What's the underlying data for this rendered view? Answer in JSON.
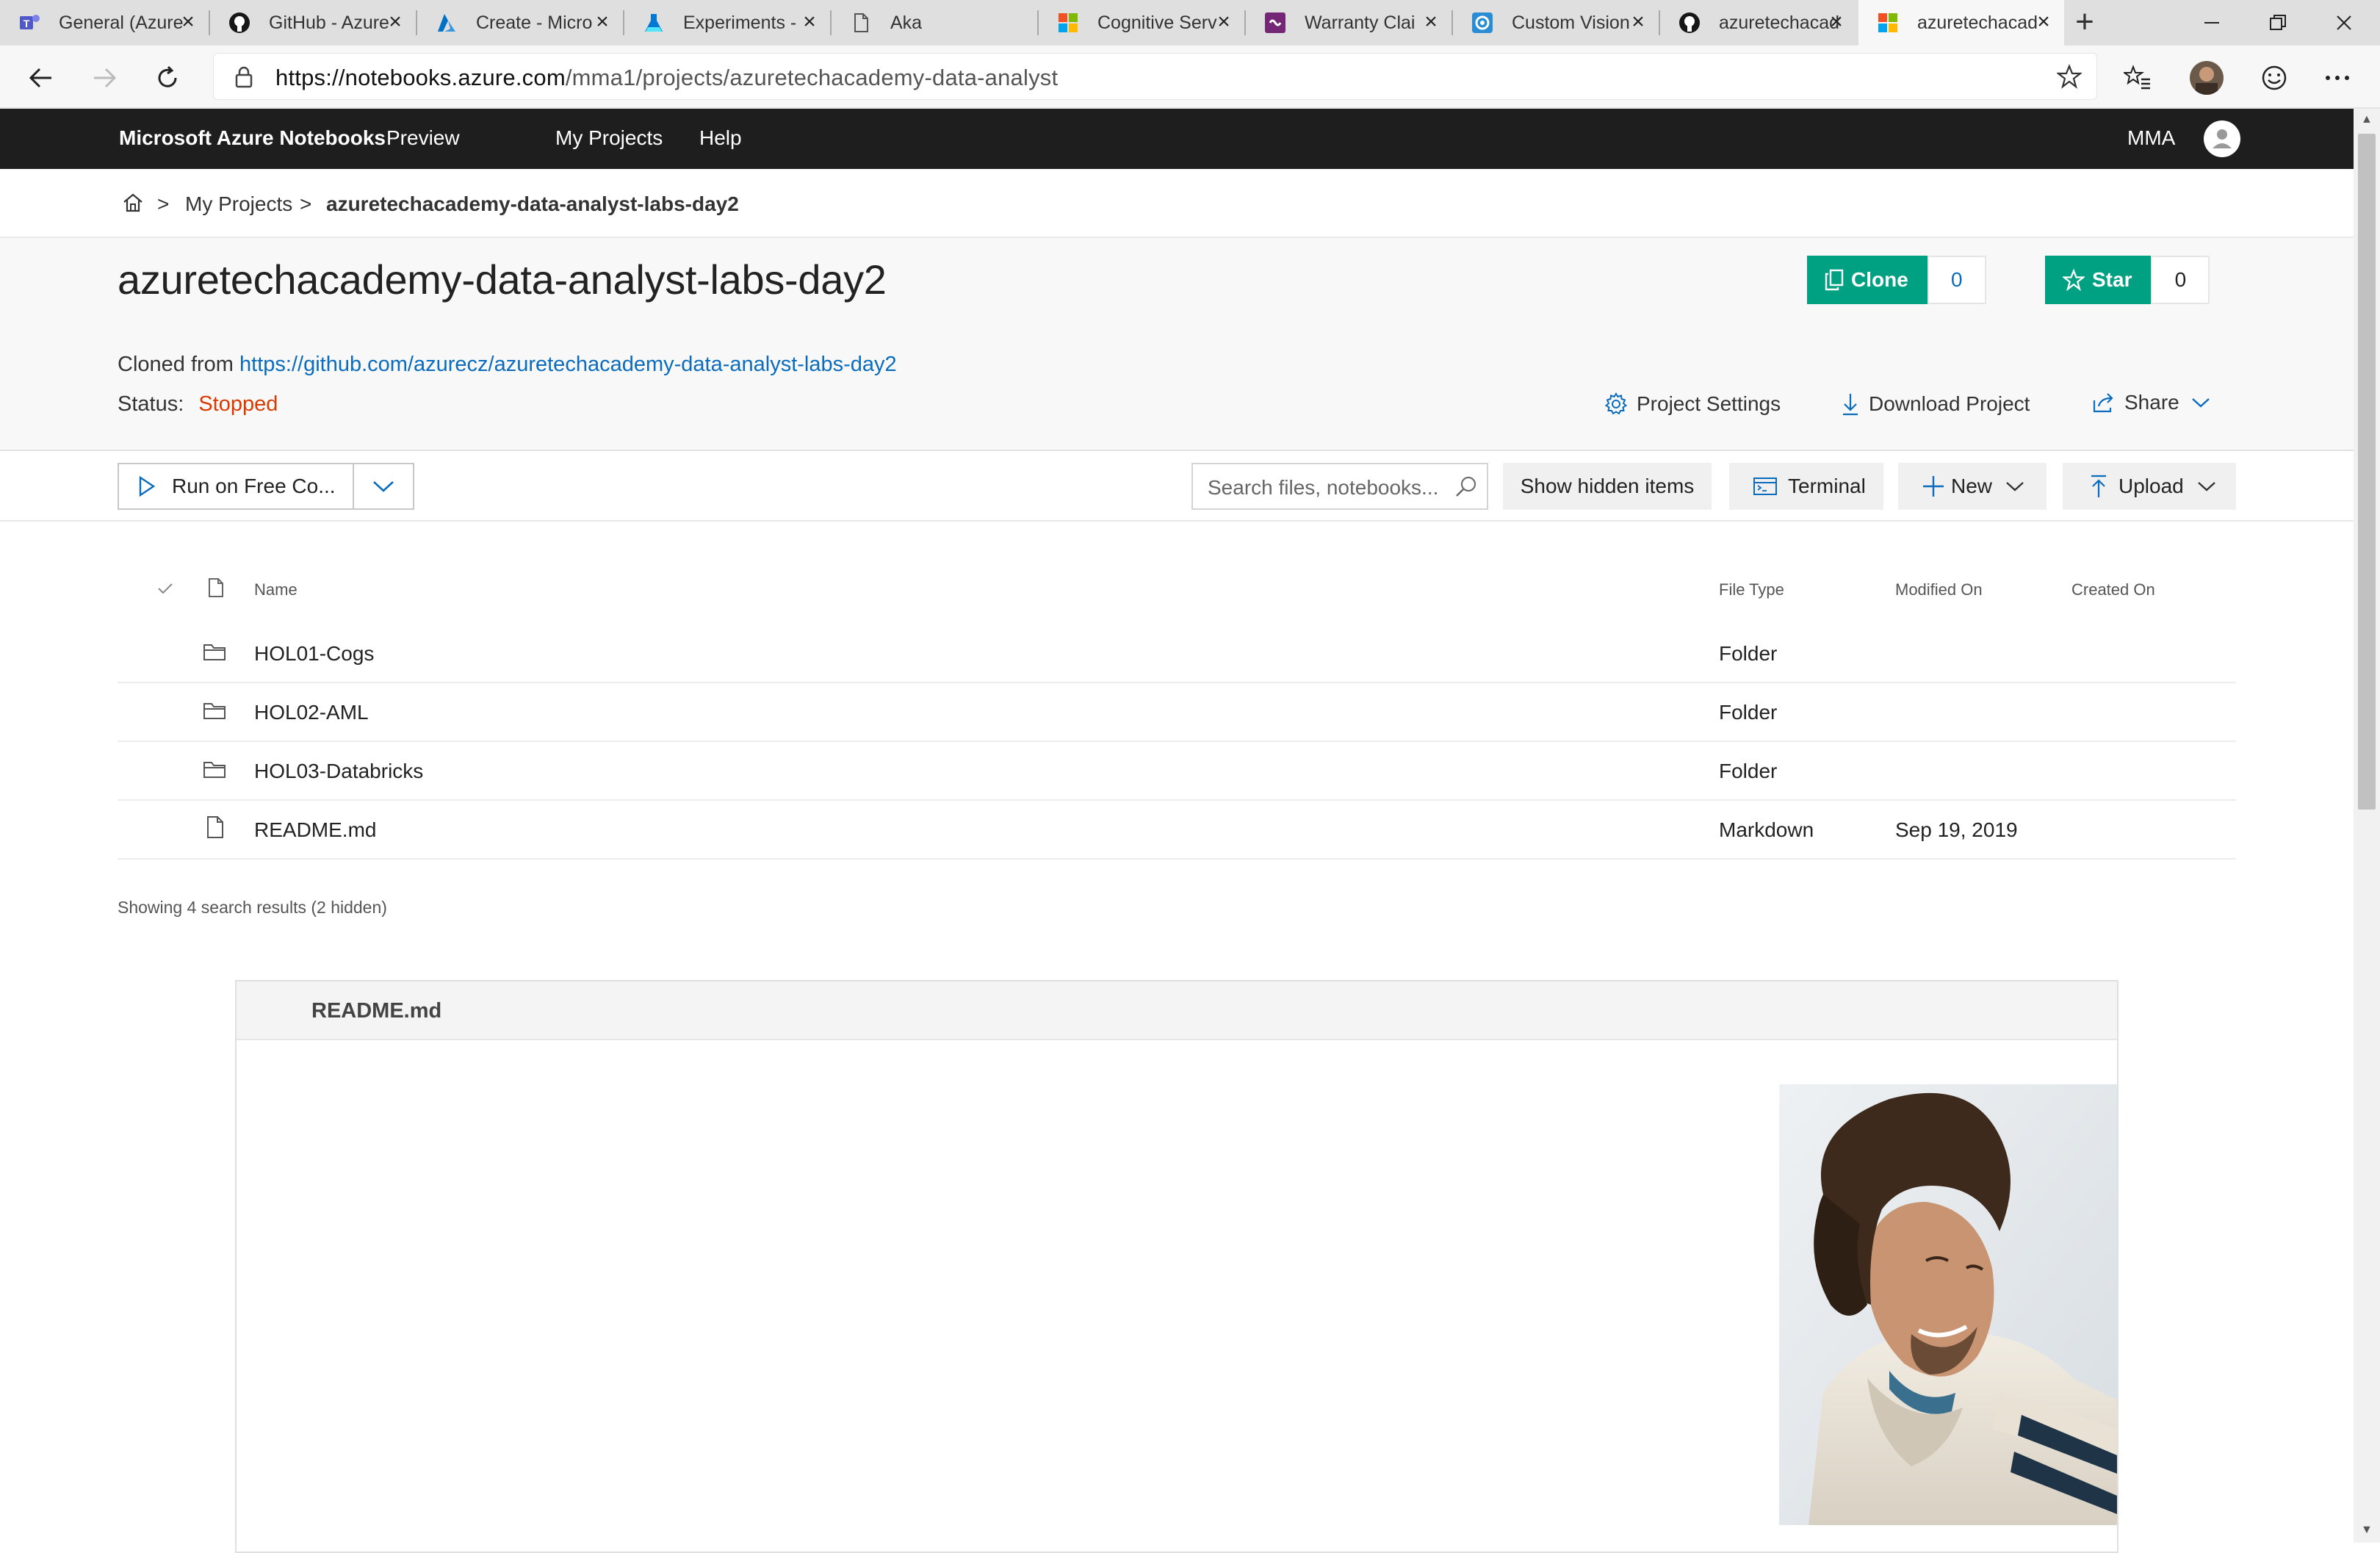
{
  "browser": {
    "tabs": [
      {
        "label": "General (Azure",
        "icon": "teams-icon"
      },
      {
        "label": "GitHub - Azure",
        "icon": "github-icon"
      },
      {
        "label": "Create - Micro",
        "icon": "azure-icon"
      },
      {
        "label": "Experiments -",
        "icon": "flask-icon"
      },
      {
        "label": "Aka",
        "icon": "page-icon"
      },
      {
        "label": "Cognitive Serv",
        "icon": "microsoft-icon"
      },
      {
        "label": "Warranty Clai",
        "icon": "powerapps-icon"
      },
      {
        "label": "Custom Vision",
        "icon": "customvision-icon"
      },
      {
        "label": "azuretechacad",
        "icon": "github-icon"
      },
      {
        "label": "azuretechacad",
        "icon": "microsoft-icon",
        "active": true
      }
    ],
    "url_host": "https://notebooks.azure.com",
    "url_path": "/mma1/projects/azuretechacademy-data-analyst"
  },
  "header": {
    "brand": "Microsoft Azure Notebooks",
    "preview": "Preview",
    "nav_my_projects": "My Projects",
    "nav_help": "Help",
    "user": "MMA"
  },
  "breadcrumb": {
    "sep": ">",
    "my_projects": "My Projects",
    "current": "azuretechacademy-data-analyst-labs-day2"
  },
  "project": {
    "title": "azuretechacademy-data-analyst-labs-day2",
    "cloned_from_label": "Cloned from",
    "cloned_from_url": "https://github.com/azurecz/azuretechacademy-data-analyst-labs-day2",
    "status_label": "Status:",
    "status_value": "Stopped",
    "clone_label": "Clone",
    "clone_count": "0",
    "star_label": "Star",
    "star_count": "0",
    "project_settings": "Project Settings",
    "download_project": "Download Project",
    "share": "Share"
  },
  "toolbar": {
    "run_label": "Run on Free Co...",
    "search_placeholder": "Search files, notebooks...",
    "show_hidden": "Show hidden items",
    "terminal": "Terminal",
    "new": "New",
    "upload": "Upload"
  },
  "files": {
    "columns": {
      "name": "Name",
      "type": "File Type",
      "modified": "Modified On",
      "created": "Created On"
    },
    "rows": [
      {
        "name": "HOL01-Cogs",
        "type": "Folder",
        "modified": "",
        "created": "",
        "icon": "folder-icon"
      },
      {
        "name": "HOL02-AML",
        "type": "Folder",
        "modified": "",
        "created": "",
        "icon": "folder-icon"
      },
      {
        "name": "HOL03-Databricks",
        "type": "Folder",
        "modified": "",
        "created": "",
        "icon": "folder-icon"
      },
      {
        "name": "README.md",
        "type": "Markdown",
        "modified": "Sep 19, 2019",
        "created": "",
        "icon": "file-icon"
      }
    ],
    "summary": "Showing 4 search results (2 hidden)"
  },
  "readme": {
    "title": "README.md"
  },
  "colors": {
    "accent_green": "#00a183",
    "link_blue": "#0b6cbd",
    "status_red": "#d83b01",
    "header_bg": "#1e1e1e"
  }
}
